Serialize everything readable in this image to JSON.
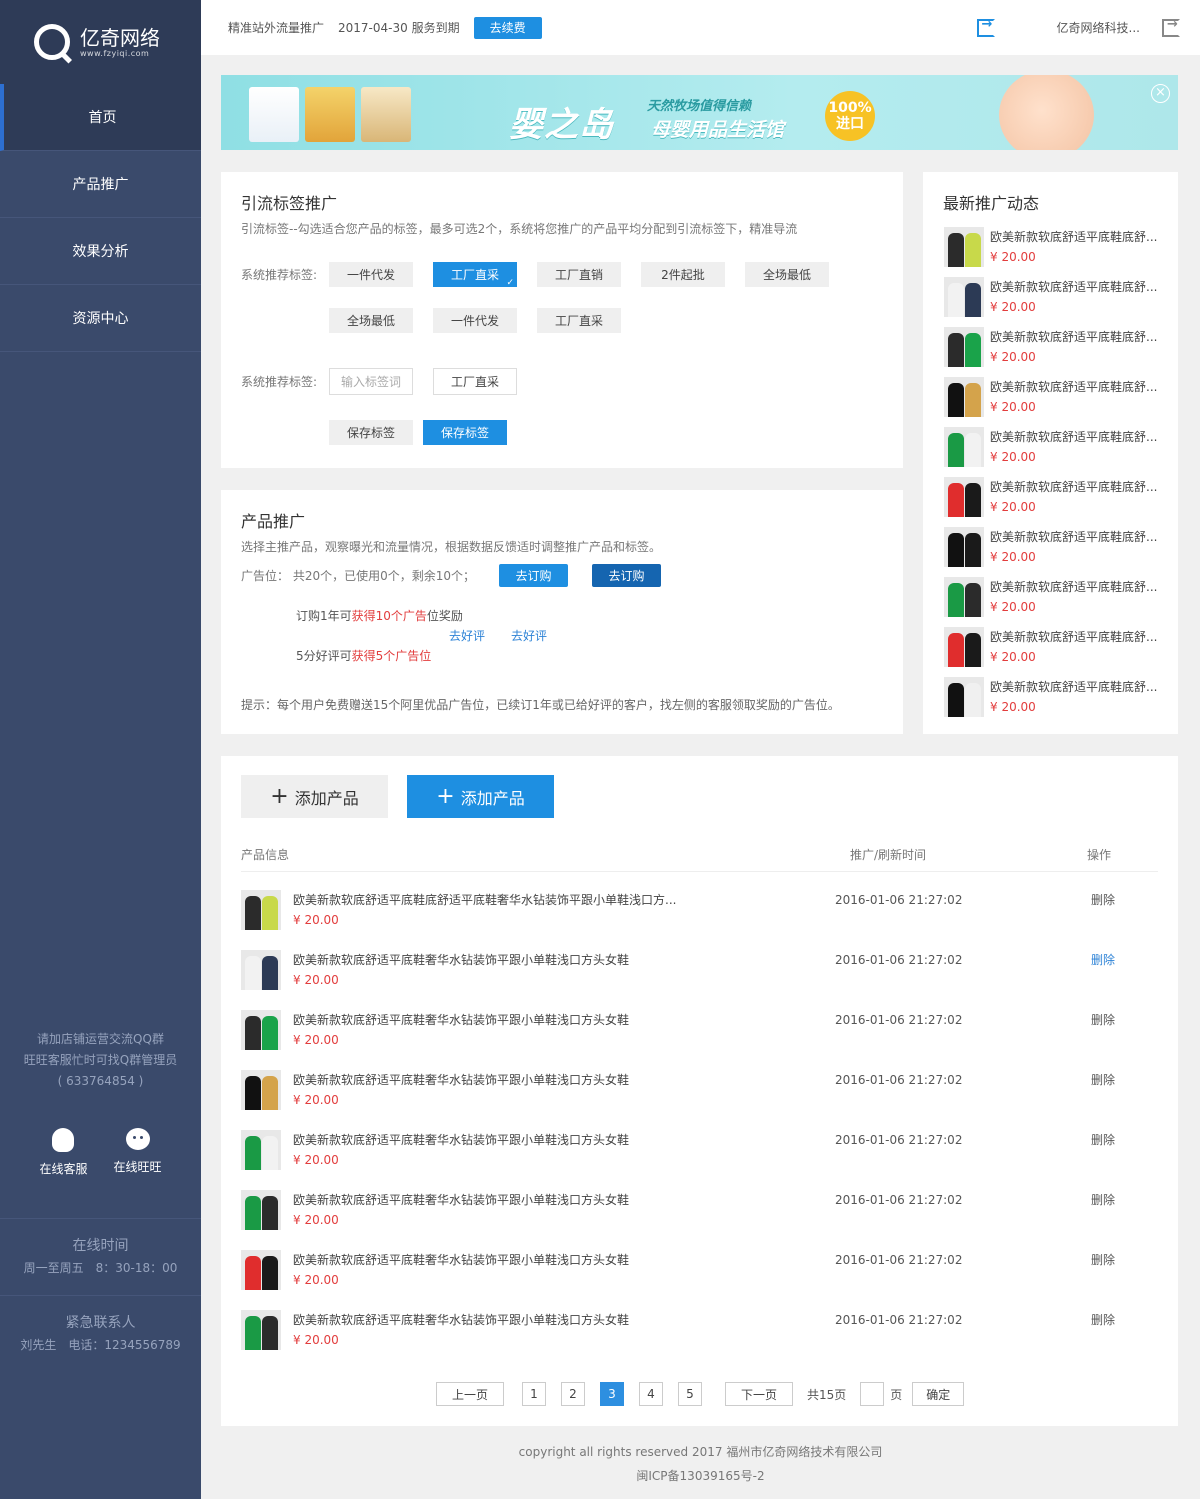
{
  "brand": {
    "name_cn": "亿奇网络",
    "url": "www.fzyiqi.com"
  },
  "nav": [
    {
      "label": "首页",
      "active": true
    },
    {
      "label": "产品推广"
    },
    {
      "label": "效果分析"
    },
    {
      "label": "资源中心"
    }
  ],
  "sidebar": {
    "qq_group_line1": "请加店铺运营交流QQ群",
    "qq_group_line2": "旺旺客服忙时可找Q群管理员",
    "qq_group_number": "( 633764854 )",
    "contact_qq": "在线客服",
    "contact_ww": "在线旺旺",
    "online_title": "在线时间",
    "online_hours": "周一至周五　8：30-18：00",
    "urgent_title": "紧急联系人",
    "urgent_info": "刘先生　电话：1234556789"
  },
  "header": {
    "service": "精准站外流量推广",
    "expire": "2017-04-30 服务到期",
    "renew_label": "去续费",
    "company": "亿奇网络科技...",
    "login_icon": "login-icon",
    "logout_icon": "logout-icon"
  },
  "banner": {
    "title": "婴之岛",
    "slogan": "天然牧场值得信赖",
    "subtitle": "母婴用品生活馆",
    "badge_top": "100%",
    "badge_bottom": "进口",
    "close": "×"
  },
  "tag_section": {
    "title": "引流标签推广",
    "desc": "引流标签--勾选适合您产品的标签，最多可选2个，系统将您推广的产品平均分配到引流标签下，精准导流",
    "label1": "系统推荐标签:",
    "tags_row1": [
      "一件代发",
      "工厂直采",
      "工厂直销",
      "2件起批",
      "全场最低"
    ],
    "tags_row2": [
      "全场最低",
      "一件代发",
      "工厂直采"
    ],
    "label2": "系统推荐标签:",
    "input_placeholder": "输入标签词",
    "input_value": "工厂直采",
    "save_gray": "保存标签",
    "save_blue": "保存标签"
  },
  "promo": {
    "title": "产品推广",
    "desc": "选择主推产品，观察曝光和流量情况，根据数据反馈适时调整推广产品和标签。",
    "slots": "广告位：  共20个，已使用0个，剩余10个；",
    "order_btn1": "去订购",
    "order_btn2": "去订购",
    "reward1_pre": "订购1年可",
    "reward1_red": "获得10个广告",
    "reward1_post": "位奖励",
    "review1": "去好评",
    "review2": "去好评",
    "reward2_pre": "5分好评可",
    "reward2_red": "获得5个广告位",
    "tip": "提示：每个用户免费赠送15个阿里优品广告位，已续订1年或已给好评的客户，找左侧的客服领取奖励的广告位。"
  },
  "feed": {
    "title": "最新推广动态",
    "items": [
      {
        "name": "欧美新款软底舒适平底鞋底舒...",
        "price": "¥ 20.00"
      },
      {
        "name": "欧美新款软底舒适平底鞋底舒...",
        "price": "¥ 20.00"
      },
      {
        "name": "欧美新款软底舒适平底鞋底舒...",
        "price": "¥ 20.00"
      },
      {
        "name": "欧美新款软底舒适平底鞋底舒...",
        "price": "¥ 20.00"
      },
      {
        "name": "欧美新款软底舒适平底鞋底舒...",
        "price": "¥ 20.00"
      },
      {
        "name": "欧美新款软底舒适平底鞋底舒...",
        "price": "¥ 20.00"
      },
      {
        "name": "欧美新款软底舒适平底鞋底舒...",
        "price": "¥ 20.00"
      },
      {
        "name": "欧美新款软底舒适平底鞋底舒...",
        "price": "¥ 20.00"
      },
      {
        "name": "欧美新款软底舒适平底鞋底舒...",
        "price": "¥ 20.00"
      },
      {
        "name": "欧美新款软底舒适平底鞋底舒...",
        "price": "¥ 20.00"
      }
    ]
  },
  "products": {
    "add_gray": "添加产品",
    "add_blue": "添加产品",
    "col_info": "产品信息",
    "col_time": "推广/刷新时间",
    "col_op": "操作",
    "rows": [
      {
        "name": "欧美新款软底舒适平底鞋底舒适平底鞋奢华水钻装饰平跟小单鞋浅口方...",
        "price": "¥ 20.00",
        "time": "2016-01-06 21:27:02",
        "op": "删除"
      },
      {
        "name": "欧美新款软底舒适平底鞋奢华水钻装饰平跟小单鞋浅口方头女鞋",
        "price": "¥ 20.00",
        "time": "2016-01-06 21:27:02",
        "op": "删除",
        "op_link": true
      },
      {
        "name": "欧美新款软底舒适平底鞋奢华水钻装饰平跟小单鞋浅口方头女鞋",
        "price": "¥ 20.00",
        "time": "2016-01-06 21:27:02",
        "op": "删除"
      },
      {
        "name": "欧美新款软底舒适平底鞋奢华水钻装饰平跟小单鞋浅口方头女鞋",
        "price": "¥ 20.00",
        "time": "2016-01-06 21:27:02",
        "op": "删除"
      },
      {
        "name": "欧美新款软底舒适平底鞋奢华水钻装饰平跟小单鞋浅口方头女鞋",
        "price": "¥ 20.00",
        "time": "2016-01-06 21:27:02",
        "op": "删除"
      },
      {
        "name": "欧美新款软底舒适平底鞋奢华水钻装饰平跟小单鞋浅口方头女鞋",
        "price": "¥ 20.00",
        "time": "2016-01-06 21:27:02",
        "op": "删除"
      },
      {
        "name": "欧美新款软底舒适平底鞋奢华水钻装饰平跟小单鞋浅口方头女鞋",
        "price": "¥ 20.00",
        "time": "2016-01-06 21:27:02",
        "op": "删除"
      },
      {
        "name": "欧美新款软底舒适平底鞋奢华水钻装饰平跟小单鞋浅口方头女鞋",
        "price": "¥ 20.00",
        "time": "2016-01-06 21:27:02",
        "op": "删除"
      }
    ]
  },
  "pager": {
    "prev": "上一页",
    "pages": [
      "1",
      "2",
      "3",
      "4",
      "5"
    ],
    "current": "3",
    "next": "下一页",
    "total": "共15页",
    "page_unit": "页",
    "confirm": "确定"
  },
  "footer": {
    "copyright": "copyright all rights reserved 2017   福州市亿奇网络技术有限公司",
    "icp": "闽ICP备13039165号-2"
  },
  "colors": {
    "accent": "#1e8fe1",
    "sidebar": "#3a4a6b",
    "sidebar_dark": "#2e3b57",
    "price": "#e23d3d"
  }
}
